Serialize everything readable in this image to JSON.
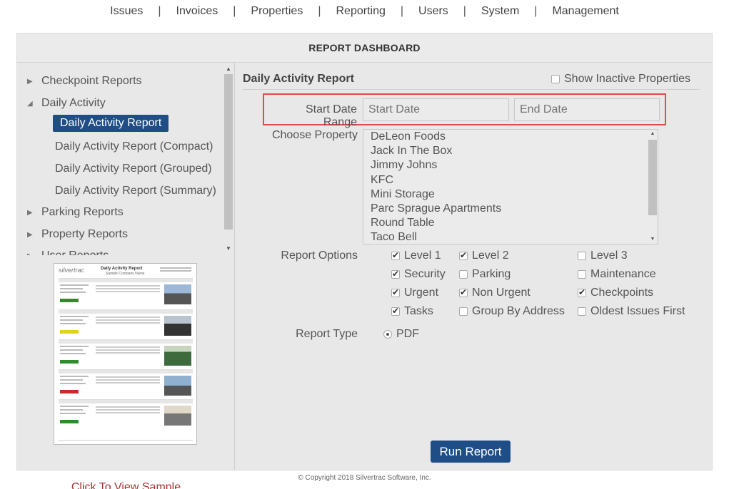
{
  "nav": {
    "items": [
      "Issues",
      "Invoices",
      "Properties",
      "Reporting",
      "Users",
      "System",
      "Management"
    ],
    "separator": "|"
  },
  "dashboard": {
    "title": "REPORT DASHBOARD"
  },
  "sidebar": {
    "nodes": [
      {
        "label": "Checkpoint Reports",
        "expanded": false
      },
      {
        "label": "Daily Activity",
        "expanded": true
      },
      {
        "label": "Parking Reports",
        "expanded": false
      },
      {
        "label": "Property Reports",
        "expanded": false
      },
      {
        "label": "User Reports",
        "expanded": false
      }
    ],
    "children": [
      {
        "label": "Daily Activity Report",
        "active": true
      },
      {
        "label": "Daily Activity Report (Compact)",
        "active": false
      },
      {
        "label": "Daily Activity Report (Grouped)",
        "active": false
      },
      {
        "label": "Daily Activity Report (Summary)",
        "active": false
      }
    ],
    "sample_link": "Click To View Sample"
  },
  "sample": {
    "logo": "silvertrac",
    "title": "Daily Activity Report",
    "company": "Sample Company Name"
  },
  "report": {
    "title": "Daily Activity Report",
    "show_inactive_label": "Show Inactive Properties",
    "show_inactive_checked": false,
    "date_range_label": "Start Date Range",
    "start_placeholder": "Start Date",
    "end_placeholder": "End Date",
    "choose_property_label": "Choose Property",
    "properties": [
      "DeLeon Foods",
      "Jack In The Box",
      "Jimmy Johns",
      "KFC",
      "Mini Storage",
      "Parc Sprague Apartments",
      "Round Table",
      "Taco Bell"
    ],
    "options_label": "Report Options",
    "options": [
      {
        "label": "Level 1",
        "checked": true
      },
      {
        "label": "Level 2",
        "checked": true
      },
      {
        "label": "Level 3",
        "checked": false
      },
      {
        "label": "Security",
        "checked": true
      },
      {
        "label": "Parking",
        "checked": false
      },
      {
        "label": "Maintenance",
        "checked": false
      },
      {
        "label": "Urgent",
        "checked": true
      },
      {
        "label": "Non Urgent",
        "checked": true
      },
      {
        "label": "Checkpoints",
        "checked": true
      },
      {
        "label": "Tasks",
        "checked": true
      },
      {
        "label": "Group By Address",
        "checked": false
      },
      {
        "label": "Oldest Issues First",
        "checked": false
      }
    ],
    "type_label": "Report Type",
    "type_option": "PDF",
    "run_label": "Run Report"
  },
  "footer": {
    "copyright": "© Copyright 2018 Silvertrac Software, Inc."
  },
  "colors": {
    "accent": "#1f4e87",
    "highlight": "#e24b4b",
    "link": "#a83232"
  }
}
